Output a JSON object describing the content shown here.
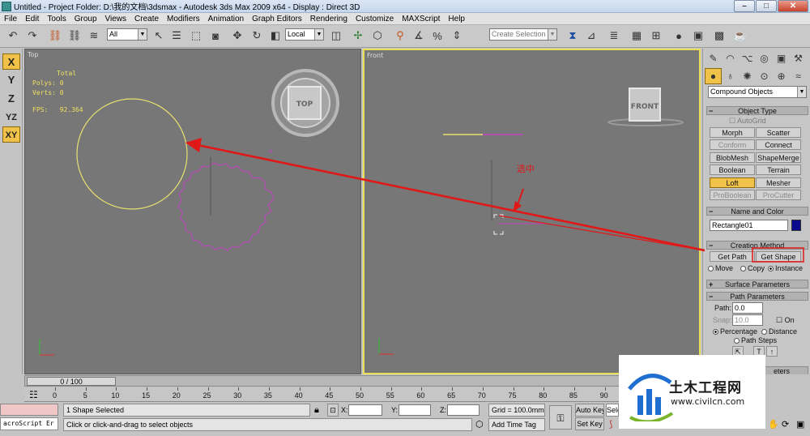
{
  "window": {
    "title": "Untitled    - Project Folder: D:\\我的文档\\3dsmax    - Autodesk 3ds Max  2009 x64      - Display : Direct 3D",
    "minimize": "–",
    "maximize": "□",
    "close": "✕"
  },
  "menu": [
    "File",
    "Edit",
    "Tools",
    "Group",
    "Views",
    "Create",
    "Modifiers",
    "Animation",
    "Graph Editors",
    "Rendering",
    "Customize",
    "MAXScript",
    "Help"
  ],
  "toolbar": {
    "selection_filter": "All",
    "ref_coord": "Local",
    "named_selection": "Create Selection Set"
  },
  "axis_constraints": [
    "X",
    "Y",
    "Z",
    "YZ",
    "XY"
  ],
  "viewports": {
    "top": {
      "label": "Top",
      "stats_header": "Total",
      "polys_label": "Polys:",
      "polys_value": "0",
      "verts_label": "Verts:",
      "verts_value": "0",
      "fps_label": "FPS:",
      "fps_value": "92.364",
      "viewcube": "TOP"
    },
    "front": {
      "label": "Front",
      "viewcube": "FRONT"
    }
  },
  "command_panel": {
    "category": "Compound Objects",
    "object_type": {
      "title": "Object Type",
      "autogrid": "AutoGrid",
      "buttons": [
        "Morph",
        "Scatter",
        "Conform",
        "Connect",
        "BlobMesh",
        "ShapeMerge",
        "Boolean",
        "Terrain",
        "Loft",
        "Mesher",
        "ProBoolean",
        "ProCutter"
      ]
    },
    "name_and_color": {
      "title": "Name and Color",
      "name": "Rectangle01",
      "color": "#0a0a8c"
    },
    "creation_method": {
      "title": "Creation Method",
      "get_path": "Get Path",
      "get_shape": "Get Shape",
      "move": "Move",
      "copy": "Copy",
      "instance": "Instance"
    },
    "surface_parameters": "Surface Parameters",
    "path_parameters": {
      "title": "Path Parameters",
      "path_label": "Path:",
      "path_value": "0.0",
      "snap_label": "Snap:",
      "snap_value": "10.0",
      "on": "On",
      "percentage": "Percentage",
      "distance": "Distance",
      "path_steps": "Path Steps"
    },
    "bottom_rollout_partial": "eters"
  },
  "timeline": {
    "frame": "0 / 100",
    "ticks": [
      "0",
      "5",
      "10",
      "15",
      "20",
      "25",
      "30",
      "35",
      "40",
      "45",
      "50",
      "55",
      "60",
      "65",
      "70",
      "75",
      "80",
      "85",
      "90",
      "95",
      "100"
    ]
  },
  "status": {
    "maxscript": "acroScript Er",
    "selection": "1 Shape Selected",
    "prompt": "Click or click-and-drag to select objects",
    "x_label": "X:",
    "y_label": "Y:",
    "z_label": "Z:",
    "grid": "Grid = 100.0mm",
    "add_time_tag": "Add Time Tag",
    "auto_key": "Auto Key",
    "set_key": "Set Key",
    "selected_partial": "Sele"
  },
  "annotation": {
    "text": "选中",
    "color": "#e01818"
  },
  "watermark": {
    "brand_cn": "土木工程网",
    "url": "www.civilcn.com"
  },
  "colors": {
    "viewport_bg": "#777777",
    "active_border": "#e9e057",
    "selected_shape": "#e8e070",
    "spline": "#c040c0",
    "highlight": "#f0c24a"
  }
}
